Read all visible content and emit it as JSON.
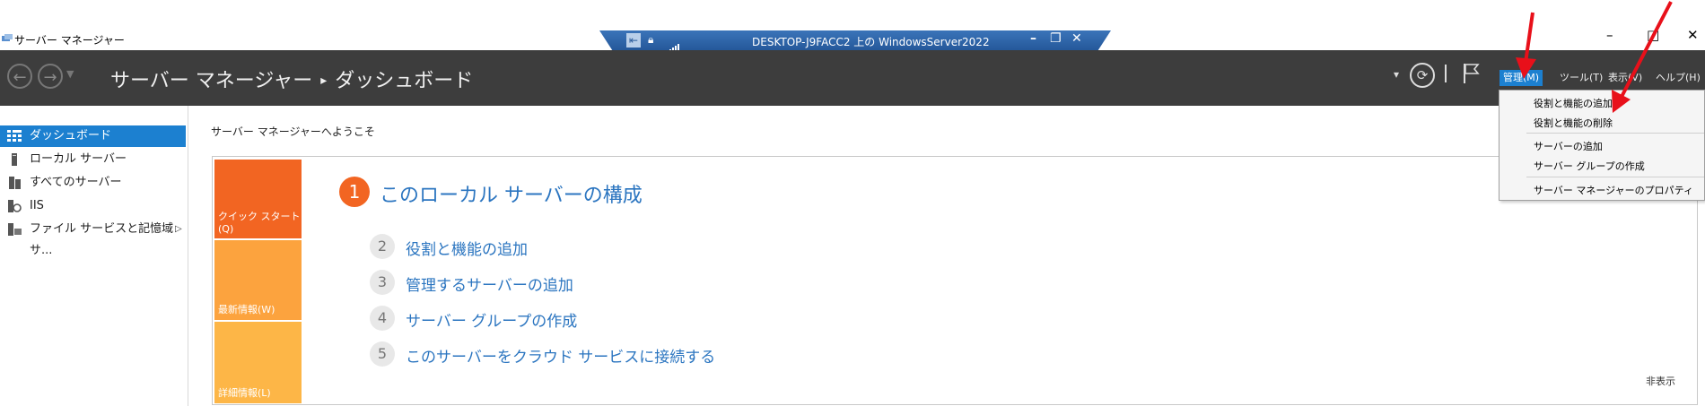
{
  "window": {
    "app_title": "サーバー マネージャー",
    "controls": {
      "minimize": "–",
      "maximize": "□",
      "close": "✕"
    }
  },
  "remote_bar": {
    "title": "DESKTOP-J9FACC2 上の WindowsServer2022",
    "controls": {
      "minimize": "–",
      "restore": "❐",
      "close": "✕"
    }
  },
  "header": {
    "breadcrumb_root": "サーバー マネージャー",
    "breadcrumb_sep": "▸",
    "breadcrumb_current": "ダッシュボード",
    "menu": {
      "manage": "管理(M)",
      "tools": "ツール(T)",
      "view": "表示(V)",
      "help": "ヘルプ(H)"
    }
  },
  "sidebar": {
    "items": [
      {
        "label": "ダッシュボード",
        "icon": "dashboard-icon",
        "active": true
      },
      {
        "label": "ローカル サーバー",
        "icon": "server-icon"
      },
      {
        "label": "すべてのサーバー",
        "icon": "servers-icon"
      },
      {
        "label": "IIS",
        "icon": "iis-icon"
      },
      {
        "label": "ファイル サービスと記憶域サ...",
        "icon": "file-services-icon"
      }
    ]
  },
  "main": {
    "welcome": "サーバー マネージャーへようこそ",
    "tabs": {
      "quick_start": "クイック スタート(Q)",
      "whats_new": "最新情報(W)",
      "learn_more": "詳細情報(L)"
    },
    "step1": {
      "number": "1",
      "title": "このローカル サーバーの構成"
    },
    "steps": [
      {
        "number": "2",
        "label": "役割と機能の追加"
      },
      {
        "number": "3",
        "label": "管理するサーバーの追加"
      },
      {
        "number": "4",
        "label": "サーバー グループの作成"
      },
      {
        "number": "5",
        "label": "このサーバーをクラウド サービスに接続する"
      }
    ],
    "hide": "非表示"
  },
  "manage_menu": {
    "items": [
      "役割と機能の追加",
      "役割と機能の削除",
      "サーバーの追加",
      "サーバー グループの作成",
      "サーバー マネージャーのプロパティ"
    ]
  },
  "colors": {
    "accent": "#1c80d0",
    "header_bg": "#3d3d3d",
    "quick_start_tab": "#f26522",
    "whats_new_tab": "#fca33e",
    "learn_more_tab": "#fdb647",
    "link": "#2b75c0",
    "annotation": "#e8101a"
  }
}
